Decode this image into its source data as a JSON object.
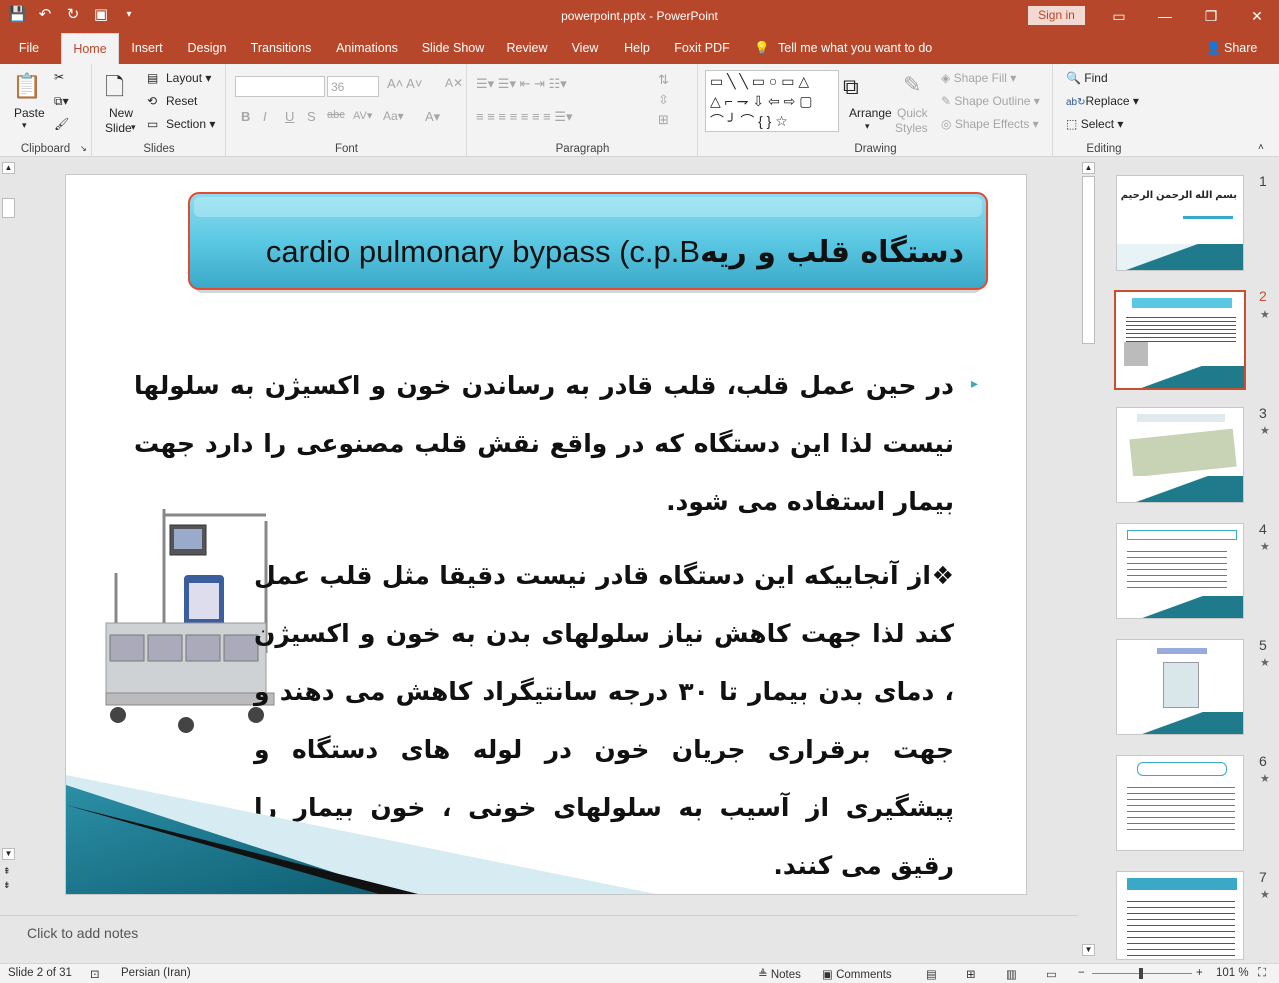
{
  "window": {
    "title": "powerpoint.pptx - PowerPoint",
    "sign_in": "Sign in"
  },
  "tabs": [
    "File",
    "Home",
    "Insert",
    "Design",
    "Transitions",
    "Animations",
    "Slide Show",
    "Review",
    "View",
    "Help",
    "Foxit PDF"
  ],
  "active_tab": "Home",
  "tell_me": "Tell me what you want to do",
  "share": "Share",
  "ribbon": {
    "clipboard": {
      "label": "Clipboard",
      "paste": "Paste"
    },
    "slides": {
      "label": "Slides",
      "new_slide_1": "New",
      "new_slide_2": "Slide",
      "layout": "Layout",
      "reset": "Reset",
      "section": "Section"
    },
    "font": {
      "label": "Font",
      "size": "36"
    },
    "paragraph": {
      "label": "Paragraph"
    },
    "drawing": {
      "label": "Drawing",
      "arrange": "Arrange",
      "quick_styles_1": "Quick",
      "quick_styles_2": "Styles",
      "shape_fill": "Shape Fill",
      "shape_outline": "Shape Outline",
      "shape_effects": "Shape Effects"
    },
    "editing": {
      "label": "Editing",
      "find": "Find",
      "replace": "Replace",
      "select": "Select"
    }
  },
  "slide": {
    "banner_en": "cardio pulmonary bypass   (c.p.B",
    "banner_fa": "دستگاه قلب و ریه",
    "paragraph1": "در حین عمل قلب، قلب قادر به رساندن خون و اکسیژن به سلولها نیست لذا این دستگاه که در واقع نقش قلب مصنوعی را دارد جهت بیمار استفاده می شود.",
    "paragraph2": "❖از آنجاییکه این دستگاه قادر نیست دقیقا مثل قلب عمل کند لذا جهت کاهش نیاز سلولهای بدن به خون و اکسیژن ، دمای بدن بیمار تا ۳۰ درجه سانتیگراد کاهش می دهند و جهت برقراری جریان خون در لوله های دستگاه و پیشگیری از آسیب به سلولهای خونی ،  خون بیمار را رقیق  می کنند."
  },
  "thumbnails": [
    {
      "num": "1",
      "title": "بسم الله الرحمن الرحیم",
      "star": false
    },
    {
      "num": "2",
      "title": "",
      "star": true
    },
    {
      "num": "3",
      "title": "",
      "star": true
    },
    {
      "num": "4",
      "title": "",
      "star": true
    },
    {
      "num": "5",
      "title": "",
      "star": true
    },
    {
      "num": "6",
      "title": "",
      "star": true
    },
    {
      "num": "7",
      "title": "",
      "star": true
    }
  ],
  "notes_placeholder": "Click to add notes",
  "status": {
    "slide_info": "Slide 2 of 31",
    "language": "Persian (Iran)",
    "notes": "Notes",
    "comments": "Comments",
    "zoom": "101 %"
  },
  "colors": {
    "accent": "#b7472a",
    "banner": "#5bc8e3",
    "teal": "#1f7a8c"
  }
}
